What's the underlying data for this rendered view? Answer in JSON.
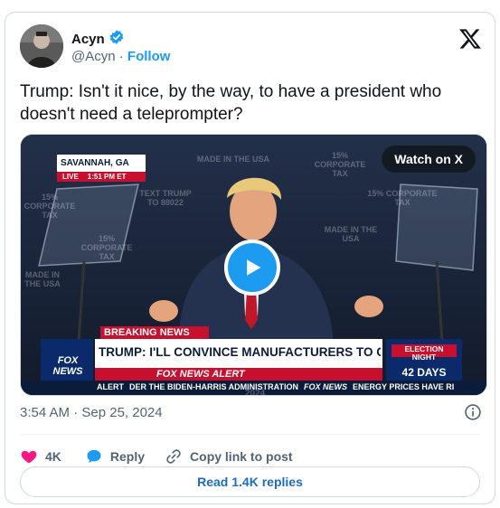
{
  "author": {
    "name": "Acyn",
    "handle": "@Acyn",
    "separator": "·",
    "follow_label": "Follow"
  },
  "tweet": {
    "text": "Trump: Isn't it nice, by the way, to have a president who doesn't need a teleprompter?",
    "timestamp": "3:54 AM · Sep 25, 2024"
  },
  "media": {
    "watch_label": "Watch on X",
    "location": "SAVANNAH, GA",
    "live_label": "LIVE",
    "live_time": "1:51 PM ET",
    "breaking_label": "BREAKING NEWS",
    "headline": "TRUMP: I'LL CONVINCE MANUFACTURERS TO COME TO U.S.",
    "alert_banner": "FOX NEWS ALERT",
    "ticker_label": "ALERT",
    "ticker_text": "DER THE BIDEN-HARRIS ADMINISTRATION",
    "ticker_text_2": "ENERGY PRICES HAVE RI",
    "ticker_brand": "FOX NEWS",
    "network_logo": "FOX NEWS",
    "election_label": "ELECTION NIGHT",
    "election_days": "42 DAYS",
    "bg_texts": [
      "MADE IN THE USA",
      "15% CORPORATE TAX",
      "TEXT TRUMP TO 88022",
      "15% CORPORATE TAX",
      "MADE IN THE USA",
      "15% CORPORATE TAX",
      "MADE IN THE USA",
      "15% CORPORATE TAX",
      "2024"
    ]
  },
  "engagement": {
    "likes": "4K",
    "reply_label": "Reply",
    "copy_label": "Copy link to post",
    "read_replies": "Read 1.4K replies"
  },
  "colors": {
    "accent": "#1d9bf0",
    "link": "#1d6bc2",
    "like": "#f91880",
    "verified": "#1d9bf0",
    "fox_red": "#c8102e"
  }
}
